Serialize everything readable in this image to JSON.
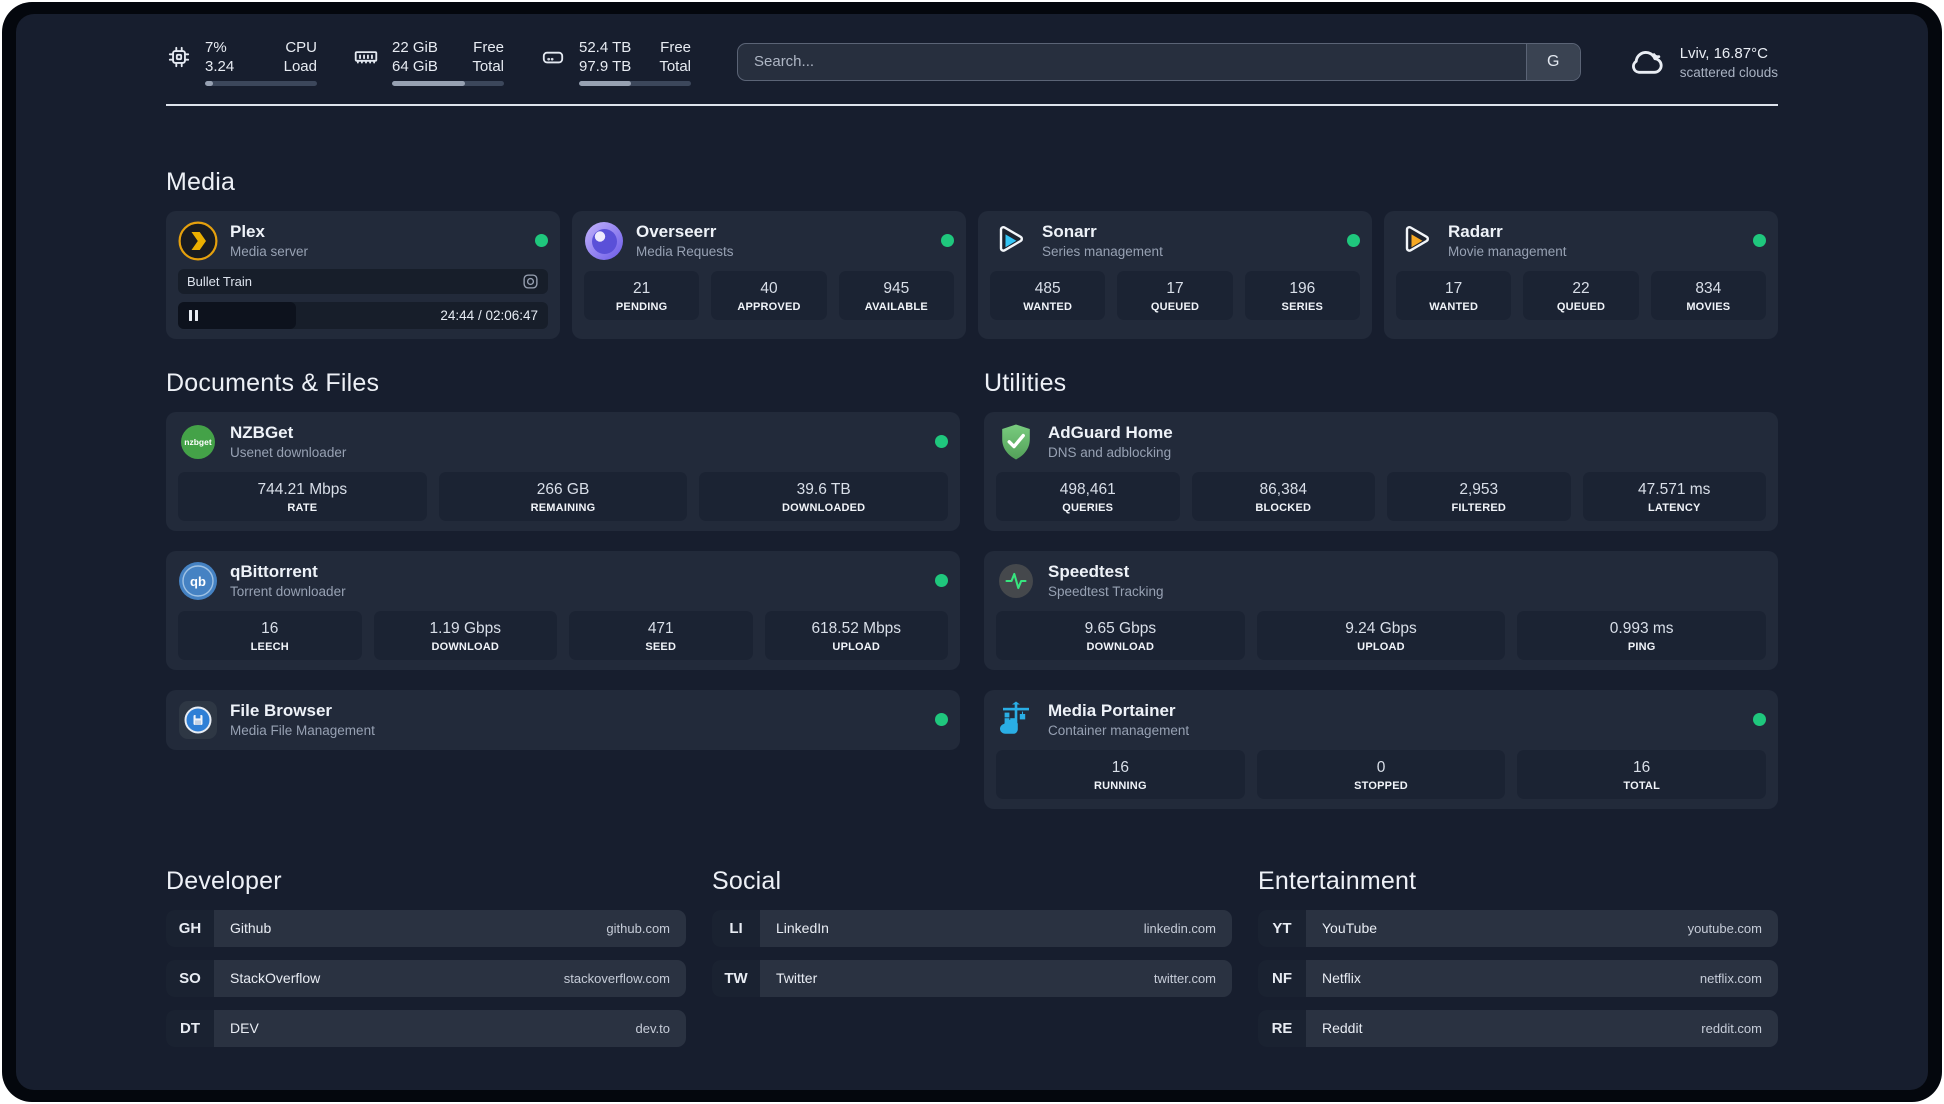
{
  "window": {
    "search_placeholder": "Search...",
    "search_button": "G"
  },
  "header": {
    "stats": [
      {
        "name": "cpu",
        "line1_value": "7%",
        "line1_label": "CPU",
        "line2_value": "3.24",
        "line2_label": "Load",
        "progress": 7
      },
      {
        "name": "memory",
        "line1_value": "22 GiB",
        "line1_label": "Free",
        "line2_value": "64 GiB",
        "line2_label": "Total",
        "progress": 65
      },
      {
        "name": "disk",
        "line1_value": "52.4 TB",
        "line1_label": "Free",
        "line2_value": "97.9 TB",
        "line2_label": "Total",
        "progress": 46
      }
    ],
    "weather": {
      "location": "Lviv, 16.87°C",
      "condition": "scattered clouds"
    }
  },
  "sections": {
    "media": {
      "title": "Media",
      "cards": {
        "plex": {
          "name": "Plex",
          "description": "Media server",
          "online": true,
          "player": {
            "title": "Bullet Train",
            "time": "24:44 / 02:06:47"
          }
        },
        "overseerr": {
          "name": "Overseerr",
          "description": "Media Requests",
          "online": true,
          "stats": [
            {
              "value": "21",
              "label": "PENDING"
            },
            {
              "value": "40",
              "label": "APPROVED"
            },
            {
              "value": "945",
              "label": "AVAILABLE"
            }
          ]
        },
        "sonarr": {
          "name": "Sonarr",
          "description": "Series management",
          "online": true,
          "stats": [
            {
              "value": "485",
              "label": "WANTED"
            },
            {
              "value": "17",
              "label": "QUEUED"
            },
            {
              "value": "196",
              "label": "SERIES"
            }
          ]
        },
        "radarr": {
          "name": "Radarr",
          "description": "Movie management",
          "online": true,
          "stats": [
            {
              "value": "17",
              "label": "WANTED"
            },
            {
              "value": "22",
              "label": "QUEUED"
            },
            {
              "value": "834",
              "label": "MOVIES"
            }
          ]
        }
      }
    },
    "documents": {
      "title": "Documents & Files",
      "cards": {
        "nzbget": {
          "name": "NZBGet",
          "description": "Usenet downloader",
          "online": true,
          "icon_text": "nzbget",
          "stats": [
            {
              "value": "744.21 Mbps",
              "label": "RATE"
            },
            {
              "value": "266 GB",
              "label": "REMAINING"
            },
            {
              "value": "39.6 TB",
              "label": "DOWNLOADED"
            }
          ]
        },
        "qbittorrent": {
          "name": "qBittorrent",
          "description": "Torrent downloader",
          "online": true,
          "icon_text": "qb",
          "stats": [
            {
              "value": "16",
              "label": "LEECH"
            },
            {
              "value": "1.19 Gbps",
              "label": "DOWNLOAD"
            },
            {
              "value": "471",
              "label": "SEED"
            },
            {
              "value": "618.52 Mbps",
              "label": "UPLOAD"
            }
          ]
        },
        "filebrowser": {
          "name": "File Browser",
          "description": "Media File Management",
          "online": true
        }
      }
    },
    "utilities": {
      "title": "Utilities",
      "cards": {
        "adguard": {
          "name": "AdGuard Home",
          "description": "DNS and adblocking",
          "stats": [
            {
              "value": "498,461",
              "label": "QUERIES"
            },
            {
              "value": "86,384",
              "label": "BLOCKED"
            },
            {
              "value": "2,953",
              "label": "FILTERED"
            },
            {
              "value": "47.571 ms",
              "label": "LATENCY"
            }
          ]
        },
        "speedtest": {
          "name": "Speedtest",
          "description": "Speedtest Tracking",
          "stats": [
            {
              "value": "9.65 Gbps",
              "label": "DOWNLOAD"
            },
            {
              "value": "9.24 Gbps",
              "label": "UPLOAD"
            },
            {
              "value": "0.993 ms",
              "label": "PING"
            }
          ]
        },
        "portainer": {
          "name": "Media Portainer",
          "description": "Container management",
          "online": true,
          "stats": [
            {
              "value": "16",
              "label": "RUNNING"
            },
            {
              "value": "0",
              "label": "STOPPED"
            },
            {
              "value": "16",
              "label": "TOTAL"
            }
          ]
        }
      }
    },
    "bookmarks": [
      {
        "title": "Developer",
        "links": [
          {
            "abbr": "GH",
            "name": "Github",
            "url": "github.com"
          },
          {
            "abbr": "SO",
            "name": "StackOverflow",
            "url": "stackoverflow.com"
          },
          {
            "abbr": "DT",
            "name": "DEV",
            "url": "dev.to"
          }
        ]
      },
      {
        "title": "Social",
        "links": [
          {
            "abbr": "LI",
            "name": "LinkedIn",
            "url": "linkedin.com"
          },
          {
            "abbr": "TW",
            "name": "Twitter",
            "url": "twitter.com"
          }
        ]
      },
      {
        "title": "Entertainment",
        "links": [
          {
            "abbr": "YT",
            "name": "YouTube",
            "url": "youtube.com"
          },
          {
            "abbr": "NF",
            "name": "Netflix",
            "url": "netflix.com"
          },
          {
            "abbr": "RE",
            "name": "Reddit",
            "url": "reddit.com"
          }
        ]
      }
    ]
  },
  "colors": {
    "status_online": "#1fc77d",
    "background": "#171e2e",
    "card": "#222a3a",
    "plex_gold": "#e5a00d",
    "sonarr_blue": "#35c5f4",
    "radarr_orange": "#f7a823",
    "portainer_blue": "#2aaee5",
    "adguard_green": "#68c16e",
    "speedtest_pulse": "#37e57f"
  }
}
